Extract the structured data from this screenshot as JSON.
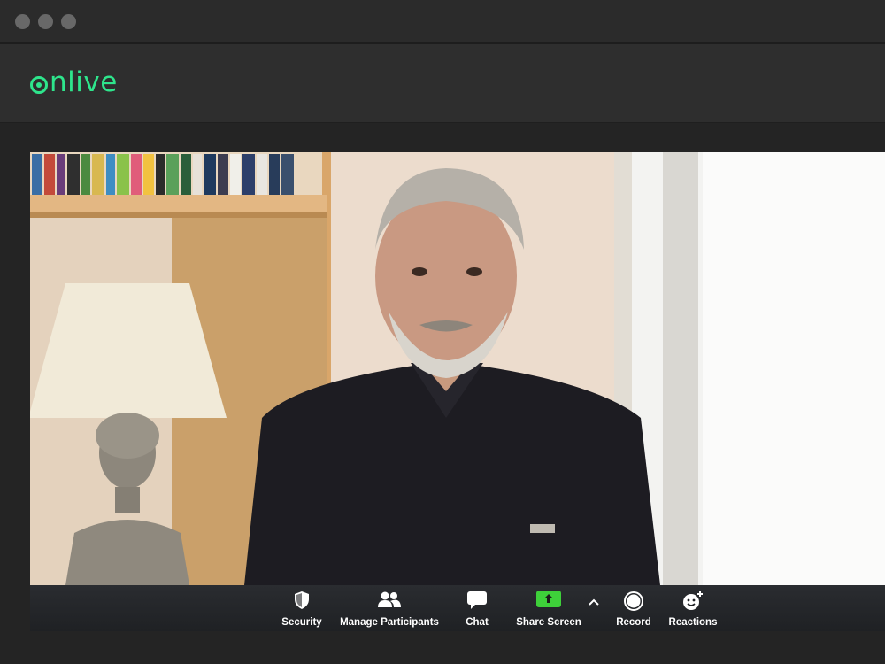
{
  "app": {
    "logo_text": "nlive"
  },
  "toolbar": {
    "security": {
      "label": "Security",
      "icon": "shield-icon"
    },
    "participants": {
      "label": "Manage Participants",
      "icon": "people-icon"
    },
    "chat": {
      "label": "Chat",
      "icon": "chat-bubble-icon"
    },
    "share": {
      "label": "Share Screen",
      "icon": "share-screen-icon"
    },
    "record": {
      "label": "Record",
      "icon": "record-icon"
    },
    "reactions": {
      "label": "Reactions",
      "icon": "smiley-add-icon"
    }
  },
  "colors": {
    "brand": "#2ee58c",
    "share_green": "#3ed03a",
    "chrome_dark": "#262626"
  }
}
